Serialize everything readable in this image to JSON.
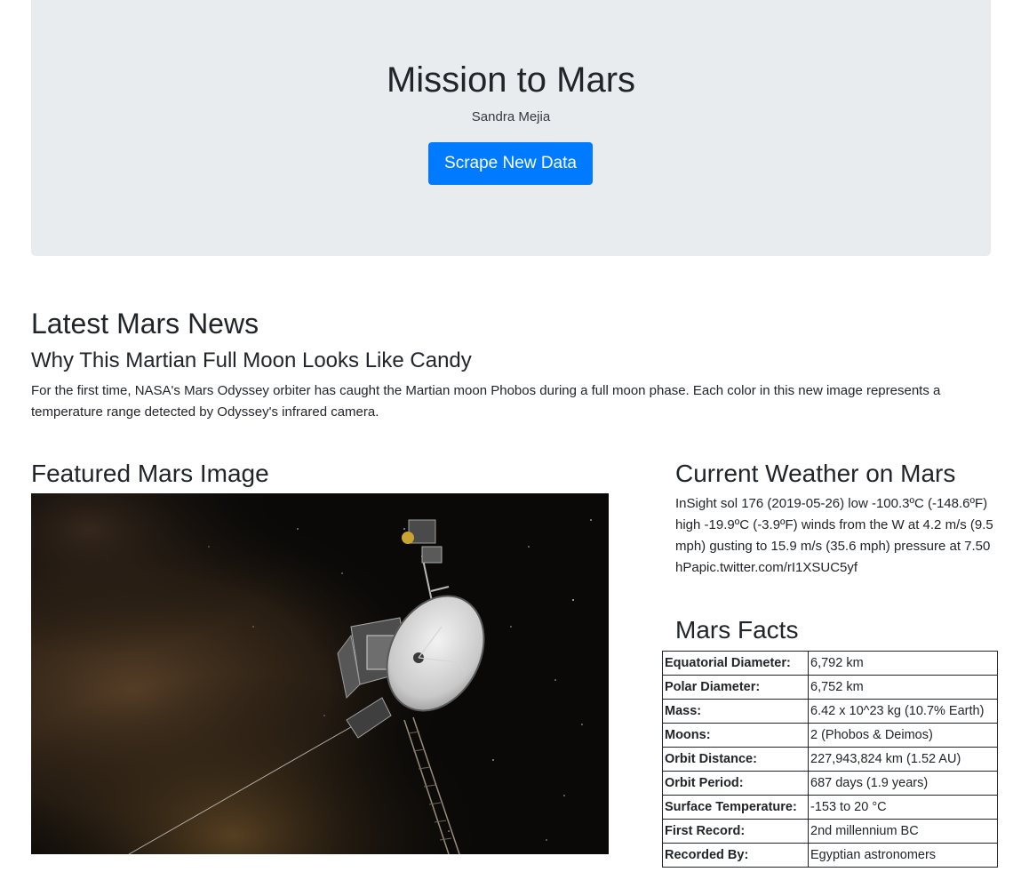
{
  "header": {
    "title": "Mission to Mars",
    "author": "Sandra Mejia",
    "button_label": "Scrape New Data",
    "button_color": "#007bff"
  },
  "news": {
    "heading": "Latest Mars News",
    "title": "Why This Martian Full Moon Looks Like Candy",
    "paragraph": "For the first time, NASA's Mars Odyssey orbiter has caught the Martian moon Phobos during a full moon phase. Each color in this new image represents a temperature range detected by Odyssey's infrared camera."
  },
  "featured": {
    "heading": "Featured Mars Image"
  },
  "weather": {
    "heading": "Current Weather on Mars",
    "text": "InSight sol 176 (2019-05-26) low -100.3ºC (-148.6ºF) high -19.9ºC (-3.9ºF) winds from the W at 4.2 m/s (9.5 mph) gusting to 15.9 m/s (35.6 mph) pressure at 7.50 hPapic.twitter.com/rI1XSUC5yf"
  },
  "facts": {
    "heading": "Mars Facts",
    "rows": [
      {
        "label": "Equatorial Diameter:",
        "value": "6,792 km"
      },
      {
        "label": "Polar Diameter:",
        "value": "6,752 km"
      },
      {
        "label": "Mass:",
        "value": "6.42 x 10^23 kg (10.7% Earth)"
      },
      {
        "label": "Moons:",
        "value": "2 (Phobos & Deimos)"
      },
      {
        "label": "Orbit Distance:",
        "value": "227,943,824 km (1.52 AU)"
      },
      {
        "label": "Orbit Period:",
        "value": "687 days (1.9 years)"
      },
      {
        "label": "Surface Temperature:",
        "value": "-153 to 20 °C"
      },
      {
        "label": "First Record:",
        "value": "2nd millennium BC"
      },
      {
        "label": "Recorded By:",
        "value": "Egyptian astronomers"
      }
    ]
  }
}
